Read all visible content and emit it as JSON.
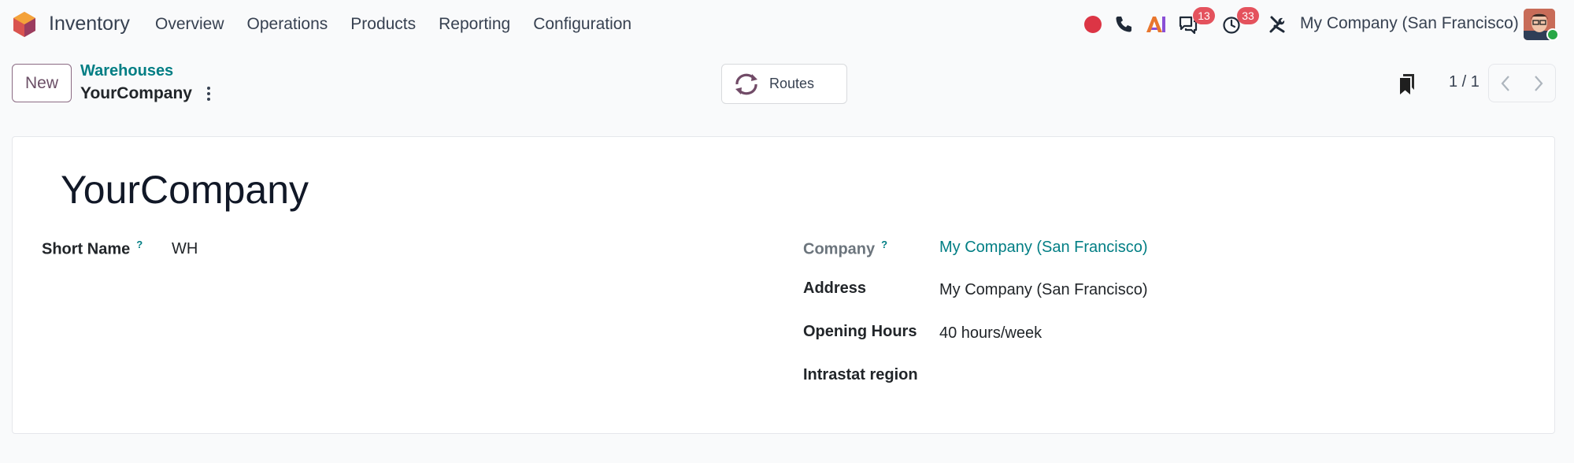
{
  "navbar": {
    "app_name": "Inventory",
    "menu": [
      "Overview",
      "Operations",
      "Products",
      "Reporting",
      "Configuration"
    ],
    "messages_count": "13",
    "activities_count": "33",
    "company": "My Company (San Francisco)",
    "icons": [
      "odoo-logo-icon",
      "record-icon",
      "phone-icon",
      "ai-icon",
      "chat-icon",
      "clock-icon",
      "tools-icon"
    ]
  },
  "control_panel": {
    "new_label": "New",
    "breadcrumb_parent": "Warehouses",
    "breadcrumb_current": "YourCompany",
    "routes_label": "Routes",
    "pager": "1 / 1"
  },
  "form": {
    "title": "YourCompany",
    "short_name_label": "Short Name",
    "short_name_value": "WH",
    "company_label": "Company",
    "company_value": "My Company (San Francisco)",
    "address_label": "Address",
    "address_value": "My Company (San Francisco)",
    "opening_hours_label": "Opening Hours",
    "opening_hours_value": "40 hours/week",
    "intrastat_label": "Intrastat region",
    "help_mark": "?"
  },
  "colors": {
    "accent": "#017e84",
    "brand": "#714b67",
    "badge": "#e4525d",
    "record": "#dc3545"
  }
}
